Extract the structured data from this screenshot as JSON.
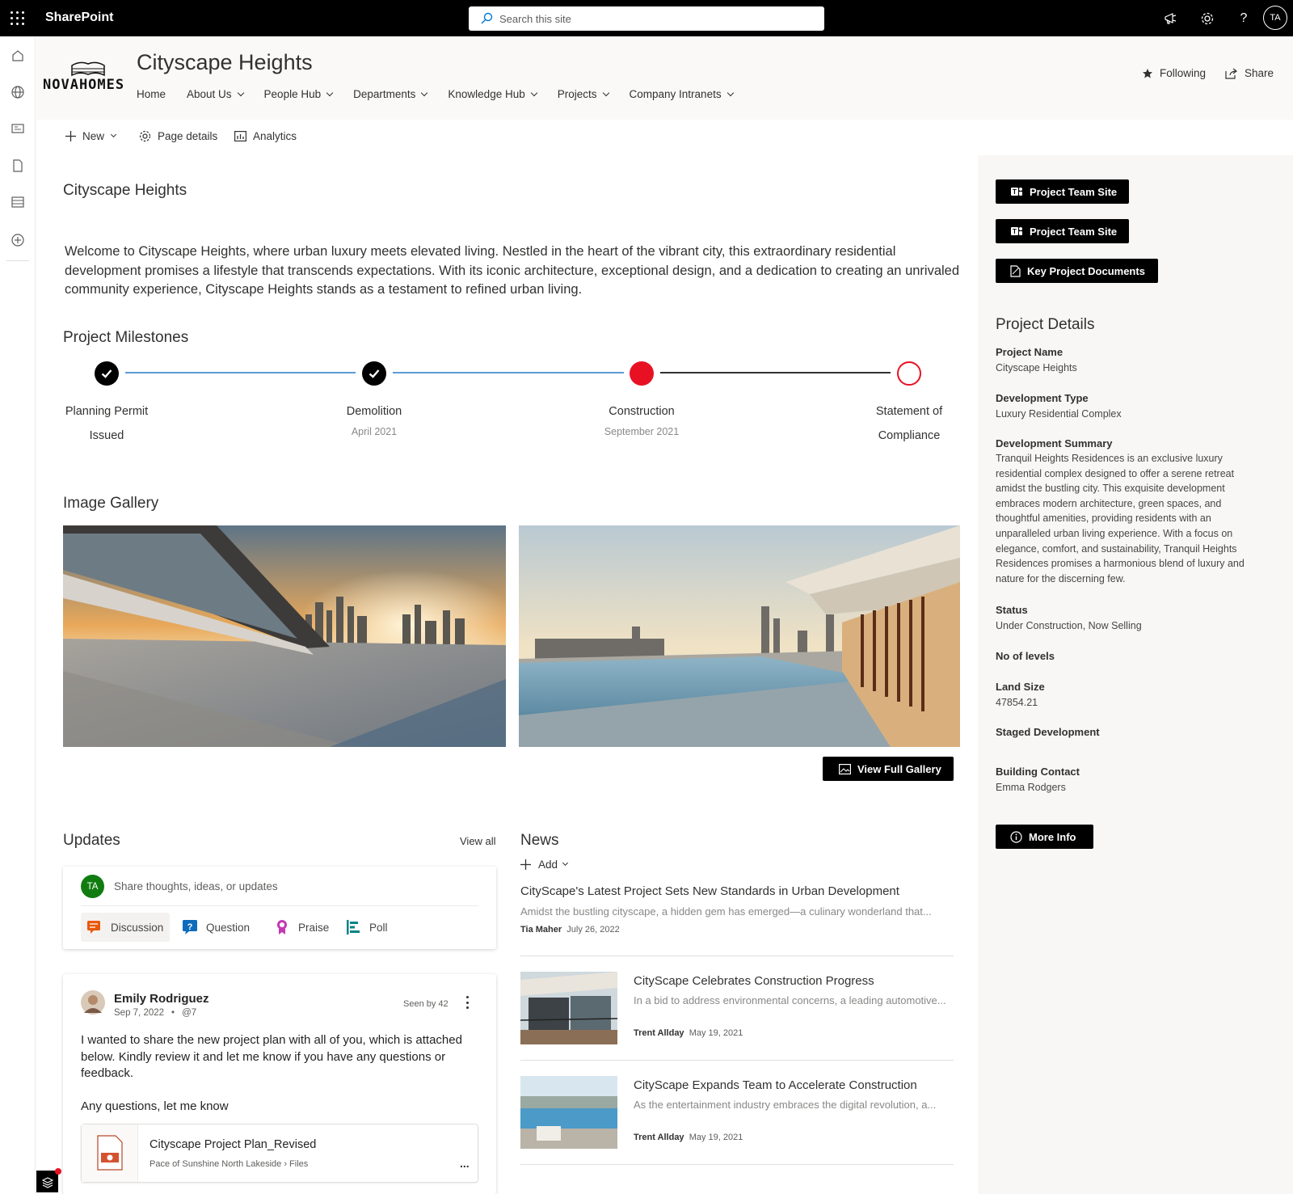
{
  "suite": {
    "app_name": "SharePoint",
    "search_placeholder": "Search this site",
    "avatar_initials": "TA"
  },
  "site": {
    "logo_text": "NOVAHOMES",
    "title": "Cityscape Heights",
    "nav": [
      "Home",
      "About Us",
      "People Hub",
      "Departments",
      "Knowledge Hub",
      "Projects",
      "Company Intranets"
    ],
    "following_label": "Following",
    "share_label": "Share"
  },
  "commands": {
    "new_label": "New",
    "page_details_label": "Page details",
    "analytics_label": "Analytics"
  },
  "intro": {
    "title": "Cityscape Heights",
    "text": "Welcome to Cityscape Heights, where urban luxury meets elevated living. Nestled in the heart of the vibrant city, this extraordinary residential development promises a lifestyle that transcends expectations. With its iconic architecture, exceptional design, and a dedication to creating an unrivaled community experience, Cityscape Heights stands as a testament to refined urban living."
  },
  "milestones": {
    "title": "Project Milestones",
    "items": [
      {
        "label_line1": "Planning Permit",
        "label_line2": "Issued",
        "date": "",
        "state": "done"
      },
      {
        "label_line1": "Demolition",
        "label_line2": "",
        "date": "April 2021",
        "state": "done"
      },
      {
        "label_line1": "Construction",
        "label_line2": "",
        "date": "September 2021",
        "state": "current"
      },
      {
        "label_line1": "Statement of",
        "label_line2": "Compliance",
        "date": "",
        "state": "upcoming"
      }
    ],
    "colors": {
      "done": "#000000",
      "current": "#e81123",
      "line_done": "#5b9bd5",
      "line_pending": "#323130"
    }
  },
  "gallery": {
    "title": "Image Gallery",
    "view_full_label": "View Full Gallery"
  },
  "updates": {
    "title": "Updates",
    "view_all": "View all",
    "composer_avatar": "TA",
    "composer_placeholder": "Share thoughts, ideas, or updates",
    "post_types": [
      "Discussion",
      "Question",
      "Praise",
      "Poll"
    ],
    "post": {
      "author": "Emily Rodriguez",
      "date": "Sep 7, 2022",
      "handle": "@7",
      "seen": "Seen by 42",
      "body": " I wanted to share the new project plan with all of you, which is attached below. Kindly review it and let me know if you have any questions or feedback.",
      "body2": "Any questions, let me know",
      "attachment_title": "Cityscape Project Plan_Revised",
      "attachment_path": "Pace of Sunshine North Lakeside › Files",
      "more": "..."
    }
  },
  "news": {
    "title": "News",
    "add_label": "Add",
    "items": [
      {
        "title": "CityScape's Latest Project Sets New Standards in Urban Development",
        "summary": "Amidst the bustling cityscape, a hidden gem has emerged—a culinary wonderland that...",
        "author": "Tia Maher",
        "date": "July 26, 2022"
      },
      {
        "title": "CityScape Celebrates Construction Progress",
        "summary": "In a bid to address environmental concerns, a leading automotive...",
        "author": "Trent Allday",
        "date": "May 19, 2021"
      },
      {
        "title": "CityScape Expands Team to Accelerate Construction",
        "summary": "As the entertainment industry embraces the digital revolution, a...",
        "author": "Trent Allday",
        "date": "May 19, 2021"
      }
    ]
  },
  "sidebar": {
    "buttons": [
      "Project Team Site",
      "Project Team Site",
      "Key Project Documents"
    ],
    "details_title": "Project Details",
    "fields": [
      {
        "label": "Project Name",
        "value": "Cityscape Heights"
      },
      {
        "label": "Development Type",
        "value": "Luxury Residential Complex"
      },
      {
        "label": "Development Summary",
        "value": "Tranquil Heights Residences is an exclusive luxury residential complex designed to offer a serene retreat amidst the bustling city. This exquisite development embraces modern architecture, green spaces, and thoughtful amenities, providing residents with an unparalleled urban living experience. With a focus on elegance, comfort, and sustainability, Tranquil Heights Residences promises a harmonious blend of luxury and nature for the discerning few."
      },
      {
        "label": "Status",
        "value": "Under Construction, Now Selling"
      },
      {
        "label": "No of levels",
        "value": ""
      },
      {
        "label": "Land Size",
        "value": "47854.21"
      },
      {
        "label": "Staged Development",
        "value": ""
      },
      {
        "label": "Building Contact",
        "value": "Emma Rodgers"
      }
    ],
    "more_info_label": "More Info"
  },
  "icons": [
    "app-launcher-icon",
    "search-icon",
    "megaphone-icon",
    "gear-icon",
    "help-icon",
    "home-icon",
    "globe-icon",
    "news-icon",
    "document-icon",
    "list-icon",
    "add-circle-icon",
    "star-icon",
    "share-icon",
    "plus-icon",
    "gear-icon",
    "analytics-icon",
    "teams-icon",
    "image-icon",
    "info-icon",
    "check-icon"
  ]
}
